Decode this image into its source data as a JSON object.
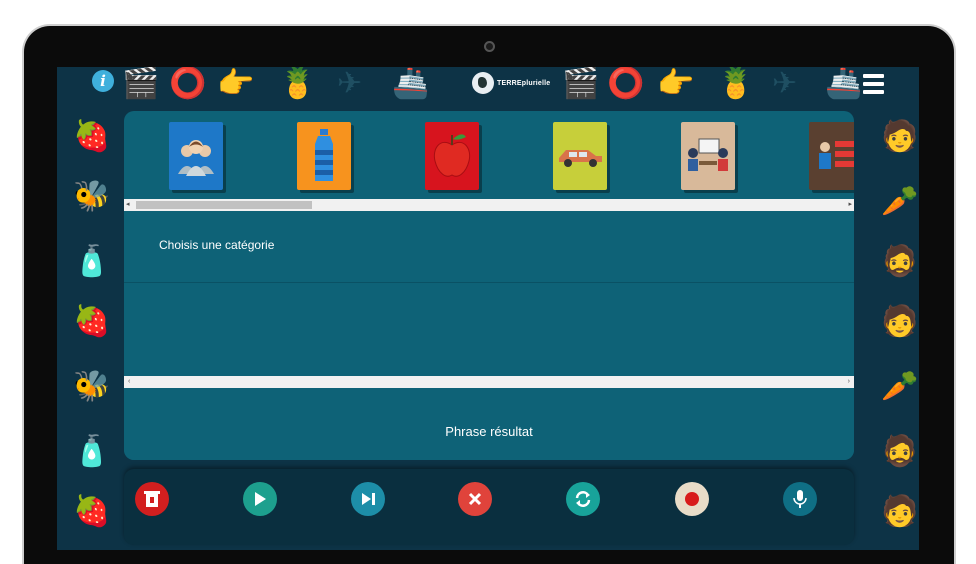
{
  "app": {
    "logo_text": "TERREplurielle"
  },
  "categories": {
    "label": "Choisis une catégorie",
    "items": [
      {
        "name": "people",
        "color": "#1e78c8",
        "icon": "people-icon"
      },
      {
        "name": "water-bottle",
        "color": "#f7931e",
        "icon": "bottle-icon"
      },
      {
        "name": "apple",
        "color": "#d7141e",
        "icon": "apple-icon"
      },
      {
        "name": "car",
        "color": "#c7cf3a",
        "icon": "car-icon"
      },
      {
        "name": "meeting",
        "color": "#d8b99a",
        "icon": "meeting-icon"
      },
      {
        "name": "presentation",
        "color": "#5a4030",
        "icon": "presenter-icon"
      }
    ]
  },
  "result": {
    "label": "Phrase résultat"
  },
  "controls": [
    {
      "name": "delete",
      "color": "#d21f1f",
      "icon": "trash-icon"
    },
    {
      "name": "play",
      "color": "#1da08e",
      "icon": "play-icon"
    },
    {
      "name": "next",
      "color": "#1d8ea8",
      "icon": "skip-next-icon"
    },
    {
      "name": "clear",
      "color": "#e0433b",
      "icon": "close-icon"
    },
    {
      "name": "refresh",
      "color": "#18a39a",
      "icon": "refresh-icon"
    },
    {
      "name": "record",
      "color": "#e8dcc8",
      "icon": "record-icon"
    },
    {
      "name": "microphone",
      "color": "#0f6f85",
      "icon": "microphone-icon"
    }
  ]
}
